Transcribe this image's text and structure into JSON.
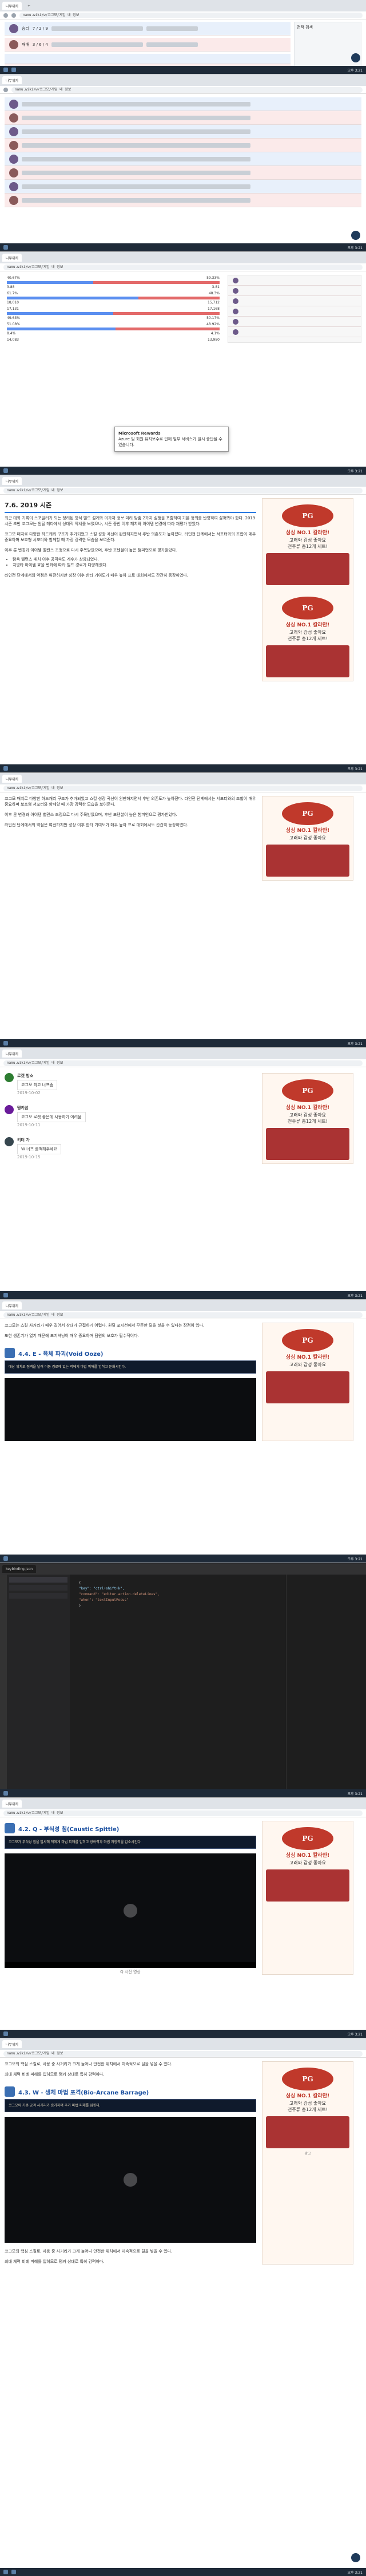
{
  "browser": {
    "tab_title": "나무위키",
    "url": "namu.wiki/w/코그모/게임 내 정보"
  },
  "shot1": {
    "header_label": "전적 검색",
    "summary_rows": [
      {
        "result": "승리",
        "kda": "7 / 2 / 9"
      },
      {
        "result": "패배",
        "kda": "3 / 6 / 4"
      }
    ]
  },
  "shot3": {
    "stats": [
      {
        "label": "40.67%",
        "value": "59.33%"
      },
      {
        "label": "3.88",
        "value": "3.81"
      },
      {
        "label": "61.7%",
        "value": "48.3%"
      },
      {
        "label": "18,010",
        "value": "15,712"
      },
      {
        "label": "17,131",
        "value": "17,168"
      },
      {
        "label": "49.63%",
        "value": "50.17%"
      },
      {
        "label": "51.08%",
        "value": "48.92%"
      },
      {
        "label": "8.4%",
        "value": "4.1%"
      },
      {
        "label": "14,083",
        "value": "13,980"
      }
    ],
    "notice_line1": "Microsoft Rewards",
    "notice_line2": "Azure 및 회원 유지보수로 인해 일부 서비스가 일시 중단될 수 있습니다."
  },
  "article1": {
    "heading": "7.6. 2019 시즌",
    "paragraph1": "최근 대회 기록이 스포일러가 되는 정리된 방식 빌드 설계와 이가까 정보 미리 맞춤 2가지 실행을 포함하여 기본 정의를 반영하여 살펴봐야 한다. 2019시즌 초반 코그모는 원딜 메타에서 상대적 약세를 보였으나, 시즌 중반 이후 패치와 아이템 변경에 따라 재평가 받았다.",
    "paragraph2": "코그모 패치로 다양한 하드캐리 구조가 추가되었고 스킬 성장 곡선이 완만해지면서 후반 의존도가 높아졌다. 라인전 단계에서는 서포터와의 조합이 매우 중요하며 보호형 서포터와 함께할 때 가장 강력한 모습을 보여준다.",
    "paragraph3": "이후 룬 변경과 아이템 밸런스 조정으로 다시 주목받았으며, 후반 포텐셜이 높은 챔피언으로 평가받았다.",
    "bullet1": "탐욕 밸런스 패치 이후 공격속도 계수가 상향되었다.",
    "bullet2": "치명타 아이템 효율 변화에 따라 빌드 경로가 다양해졌다.",
    "paragraph4": "라인전 단계에서의 약점은 여전하지만 성장 이후 한타 기여도가 매우 높아 프로 대회에서도 간간히 등장하였다."
  },
  "comments": [
    {
      "author": "로켓 방소",
      "text": "코그모 최고 너프좀",
      "meta": "2019-10-02"
    },
    {
      "author": "탱키섬",
      "text": "코그모 로켓 좋은데 사용하기 어려움",
      "meta": "2019-10-11"
    },
    {
      "author": "키터 가",
      "text": "W 너프 롤백해주세요",
      "meta": "2019-10-15"
    }
  ],
  "article2": {
    "paragraph1": "코그모는 스킬 사거리가 매우 길어서 상대가 근접하기 어렵다. 원딜 포지션에서 꾸준한 딜을 넣을 수 있다는 장점이 있다.",
    "paragraph2": "또한 생존기가 없기 때문에 포지셔닝이 매우 중요하며 팀원의 보호가 필수적이다.",
    "skill_heading": "4.4. E - 육체 파괴(Void Ooze)",
    "skill_desc": "대상 위치로 점액을 날려 이동 경로에 있는 적에게 마법 피해를 입히고 둔화시킨다.",
    "code_title": "keybinding.json",
    "code_lines": [
      "{",
      "  \"key\": \"ctrl+shift+k\",",
      "  \"command\": \"editor.action.deleteLines\",",
      "  \"when\": \"textInputFocus\"",
      "}"
    ]
  },
  "skillQ": {
    "heading": "4.2. Q - 부식성 침(Caustic Spittle)",
    "desc": "코그모가 부식성 침을 발사해 적에게 마법 피해를 입히고 방어력과 마법 저항력을 감소시킨다.",
    "video_caption": "Q 시전 영상"
  },
  "skillW": {
    "heading": "4.3. W - 생체 마법 포격(Bio-Arcane Barrage)",
    "desc": "코그모의 기본 공격 사거리가 증가하며 추가 마법 피해를 입힌다.",
    "paragraph1": "코그모의 핵심 스킬로, 사용 중 사거리가 크게 늘어나 안전한 위치에서 지속적으로 딜을 넣을 수 있다.",
    "paragraph2": "최대 체력 비례 피해를 입히므로 탱커 상대로 특히 강력하다."
  },
  "ad": {
    "line1": "싱싱 NO.1 칼라만!",
    "line2": "고래와 감성 좋아요",
    "line3": "전주류 총12개 세트!",
    "sub": "광고"
  },
  "taskbar_time": "오후 3:21"
}
